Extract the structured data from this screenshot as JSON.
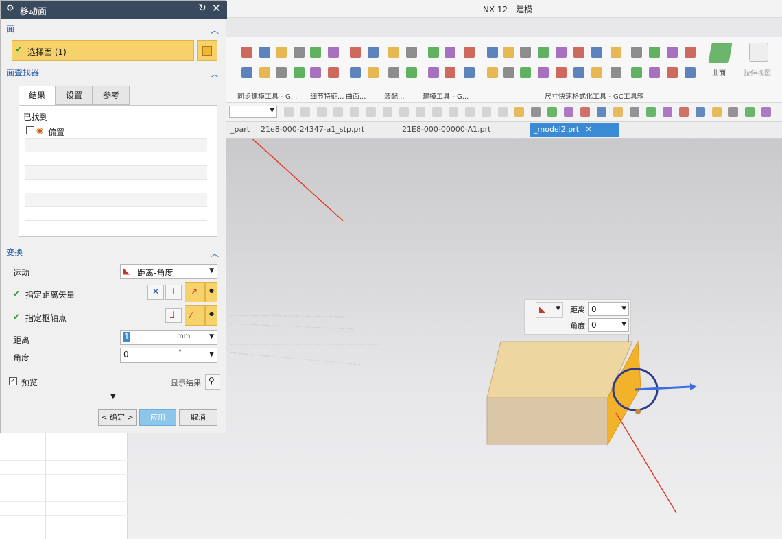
{
  "app": {
    "title": "NX 12 - 建模"
  },
  "dialog": {
    "title": "移动面",
    "face_section": {
      "header": "面",
      "select_label": "选择面 (1)"
    },
    "region_section": {
      "header": "面查找器",
      "tabs": [
        "结果",
        "设置",
        "参考"
      ],
      "found_label": "已找到",
      "found_items": [
        "偏置"
      ]
    },
    "transform_section": {
      "header": "变换",
      "motion_label": "运动",
      "motion_value": "距离-角度",
      "vector_label": "指定距离矢量",
      "point_label": "指定枢轴点",
      "distance_label": "距离",
      "distance_value": "1",
      "distance_unit": "mm",
      "angle_label": "角度",
      "angle_value": "0",
      "angle_unit": "°"
    },
    "preview_label": "预览",
    "show_result_label": "显示结果",
    "ok_label": "< 确定 >",
    "apply_label": "应用",
    "cancel_label": "取消"
  },
  "ribbon": {
    "groups": [
      "同步建模工具 - G...",
      "细节特征...",
      "曲面...",
      "装配...",
      "建模工具 - G...",
      "尺寸快速格式化工具 - GC工具箱"
    ],
    "extra_labels": [
      "曲面",
      "拉伸视图"
    ]
  },
  "doc_tabs": [
    {
      "label": "_part"
    },
    {
      "label": "21e8-000-24347-a1_stp.prt"
    },
    {
      "label": "21E8-000-00000-A1.prt"
    },
    {
      "label": "_model2.prt"
    }
  ],
  "float_panel": {
    "distance_label": "距离",
    "distance_value": "0",
    "angle_label": "角度",
    "angle_value": "0"
  },
  "colors": {
    "dialog_title_bg": "#3a4a5e",
    "highlight": "#f7d26a",
    "active_tab": "#3a8ad6",
    "block_top": "#eed6a0",
    "block_side": "#dcc6a8",
    "selected_face": "#f2b22a",
    "annotation_line": "#e23a2a"
  }
}
